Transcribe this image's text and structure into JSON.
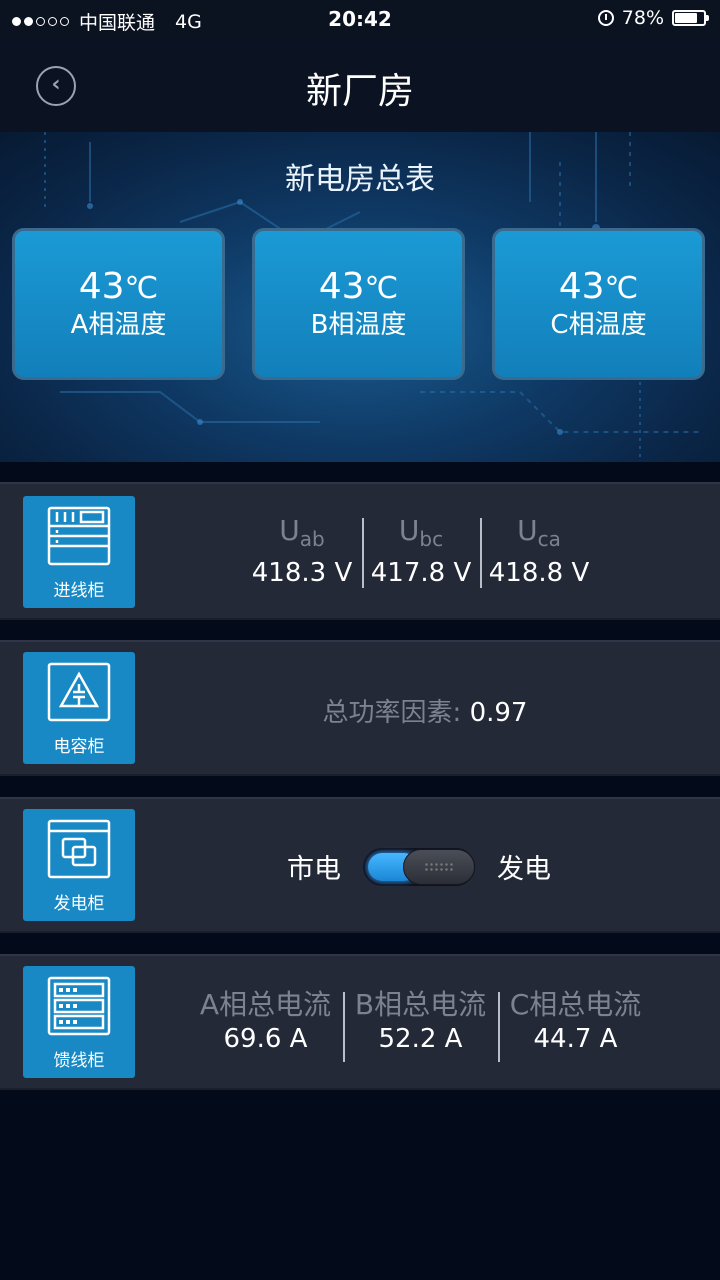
{
  "status_bar": {
    "carrier": "中国联通",
    "network": "4G",
    "time": "20:42",
    "battery": "78%",
    "battery_level": 0.78,
    "signal_bars": 2
  },
  "header": {
    "title": "新厂房"
  },
  "hero": {
    "title": "新电房总表",
    "temperatures": [
      {
        "value": "43",
        "unit": "℃",
        "label": "A相温度"
      },
      {
        "value": "43",
        "unit": "℃",
        "label": "B相温度"
      },
      {
        "value": "43",
        "unit": "℃",
        "label": "C相温度"
      }
    ]
  },
  "incoming": {
    "icon_label": "进线柜",
    "voltages": [
      {
        "symbol": "U",
        "sub": "ab",
        "value": "418.3 V"
      },
      {
        "symbol": "U",
        "sub": "bc",
        "value": "417.8 V"
      },
      {
        "symbol": "U",
        "sub": "ca",
        "value": "418.8 V"
      }
    ]
  },
  "capacitor": {
    "icon_label": "电容柜",
    "power_factor_label": "总功率因素:",
    "power_factor_value": "0.97"
  },
  "generator": {
    "icon_label": "发电柜",
    "left_label": "市电",
    "right_label": "发电",
    "toggle_on": "left"
  },
  "feeder": {
    "icon_label": "馈线柜",
    "currents": [
      {
        "label": "A相总电流",
        "value": "69.6 A"
      },
      {
        "label": "B相总电流",
        "value": "52.2 A"
      },
      {
        "label": "C相总电流",
        "value": "44.7 A"
      }
    ]
  },
  "colors": {
    "accent": "#1889c5",
    "band": "#242938",
    "background": "#030b1a"
  }
}
